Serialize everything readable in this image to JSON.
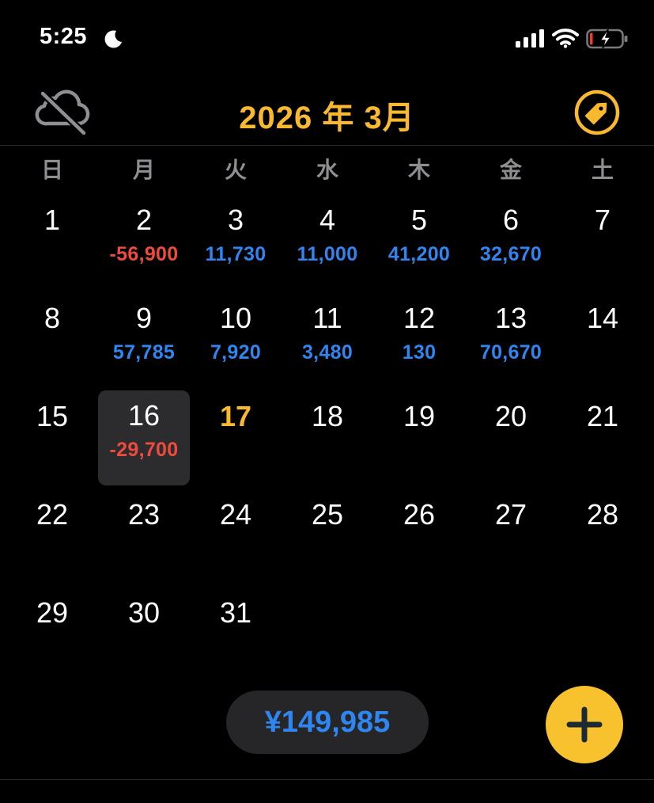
{
  "status_bar": {
    "time": "5:25",
    "icons": [
      "moon-icon",
      "cellular-signal-icon",
      "wifi-icon",
      "battery-charging-icon"
    ]
  },
  "header": {
    "title": "2026 年 3月",
    "left_icon": "cloud-off-icon",
    "right_icon": "tag-icon",
    "accent_color": "#f8b92e"
  },
  "weekdays": [
    "日",
    "月",
    "火",
    "水",
    "木",
    "金",
    "土"
  ],
  "calendar": {
    "weeks": [
      [
        {
          "day": "1",
          "amount": ""
        },
        {
          "day": "2",
          "amount": "-56,900",
          "sign": "neg"
        },
        {
          "day": "3",
          "amount": "11,730",
          "sign": "pos"
        },
        {
          "day": "4",
          "amount": "11,000",
          "sign": "pos"
        },
        {
          "day": "5",
          "amount": "41,200",
          "sign": "pos"
        },
        {
          "day": "6",
          "amount": "32,670",
          "sign": "pos"
        },
        {
          "day": "7",
          "amount": ""
        }
      ],
      [
        {
          "day": "8",
          "amount": ""
        },
        {
          "day": "9",
          "amount": "57,785",
          "sign": "pos"
        },
        {
          "day": "10",
          "amount": "7,920",
          "sign": "pos"
        },
        {
          "day": "11",
          "amount": "3,480",
          "sign": "pos"
        },
        {
          "day": "12",
          "amount": "130",
          "sign": "pos"
        },
        {
          "day": "13",
          "amount": "70,670",
          "sign": "pos"
        },
        {
          "day": "14",
          "amount": ""
        }
      ],
      [
        {
          "day": "15",
          "amount": ""
        },
        {
          "day": "16",
          "amount": "-29,700",
          "sign": "neg",
          "selected": true
        },
        {
          "day": "17",
          "amount": "",
          "today": true
        },
        {
          "day": "18",
          "amount": ""
        },
        {
          "day": "19",
          "amount": ""
        },
        {
          "day": "20",
          "amount": ""
        },
        {
          "day": "21",
          "amount": ""
        }
      ],
      [
        {
          "day": "22",
          "amount": ""
        },
        {
          "day": "23",
          "amount": ""
        },
        {
          "day": "24",
          "amount": ""
        },
        {
          "day": "25",
          "amount": ""
        },
        {
          "day": "26",
          "amount": ""
        },
        {
          "day": "27",
          "amount": ""
        },
        {
          "day": "28",
          "amount": ""
        }
      ],
      [
        {
          "day": "29",
          "amount": ""
        },
        {
          "day": "30",
          "amount": ""
        },
        {
          "day": "31",
          "amount": ""
        }
      ]
    ],
    "colors": {
      "positive": "#2f86f0",
      "negative": "#ee4b3f",
      "today": "#f8b92e"
    }
  },
  "footer": {
    "total": "¥149,985",
    "add_icon": "plus-icon",
    "add_button_color": "#f8c22e"
  }
}
